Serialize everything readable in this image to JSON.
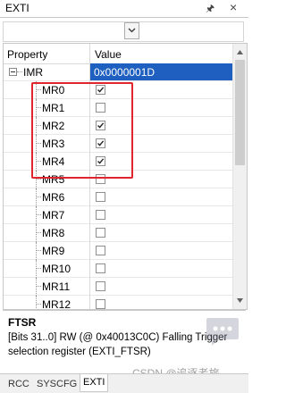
{
  "window": {
    "title": "EXTI",
    "pin_icon": "pin-icon",
    "close_icon": "close-icon"
  },
  "selector": {
    "value": "",
    "icon": "chevron-down-icon"
  },
  "grid": {
    "header": {
      "property": "Property",
      "value": "Value"
    },
    "parent": {
      "name": "IMR",
      "value": "0x0000001D",
      "expanded": true
    },
    "rows": [
      {
        "name": "MR0",
        "checked": true
      },
      {
        "name": "MR1",
        "checked": false
      },
      {
        "name": "MR2",
        "checked": true
      },
      {
        "name": "MR3",
        "checked": true
      },
      {
        "name": "MR4",
        "checked": true
      },
      {
        "name": "MR5",
        "checked": false
      },
      {
        "name": "MR6",
        "checked": false
      },
      {
        "name": "MR7",
        "checked": false
      },
      {
        "name": "MR8",
        "checked": false
      },
      {
        "name": "MR9",
        "checked": false
      },
      {
        "name": "MR10",
        "checked": false
      },
      {
        "name": "MR11",
        "checked": false
      },
      {
        "name": "MR12",
        "checked": false
      }
    ]
  },
  "description": {
    "title": "FTSR",
    "text": "[Bits 31..0] RW (@ 0x40013C0C) Falling Trigger selection register (EXTI_FTSR)"
  },
  "watermark": "CSDN @追逐者旅",
  "tabs": [
    {
      "label": "RCC",
      "active": false
    },
    {
      "label": "SYSCFG",
      "active": false
    },
    {
      "label": "EXTI",
      "active": true
    }
  ],
  "colors": {
    "selection": "#1e5fbf",
    "highlight_box": "#e0262c"
  }
}
